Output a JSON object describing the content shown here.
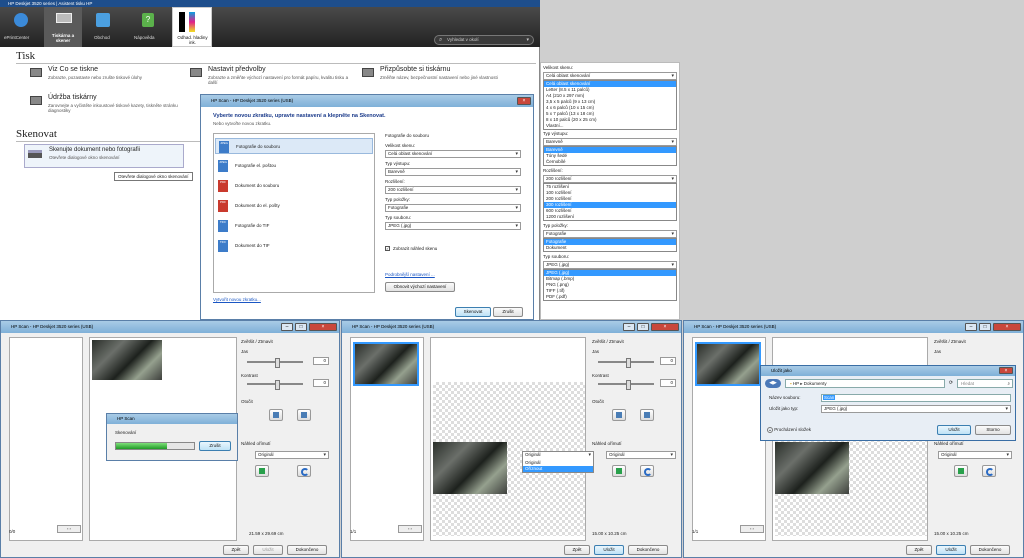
{
  "assistant": {
    "title": "HP Deskjet 3520 series | Asistent tisku HP",
    "tabs": [
      {
        "label": "ePrintCenter"
      },
      {
        "label": "Tiskárna a skener"
      },
      {
        "label": "Obchod"
      },
      {
        "label": "Nápověda"
      },
      {
        "label": "Odhad. hladiny ink."
      }
    ],
    "search_placeholder": "Vyhledat v okolí",
    "print_heading": "Tisk",
    "print_items": [
      {
        "title": "Viz Co se tiskne",
        "desc": "Zobrazte, pozastavte nebo zrušte tiskové úlohy"
      },
      {
        "title": "Nastavit předvolby",
        "desc": "Zobrazte a změňte výchozí nastavení pro formát papíru, kvalitu tisku a další"
      },
      {
        "title": "Přizpůsobte si tiskárnu",
        "desc": "Změňte název, bezpečnostní nastavení nebo jiné vlastnosti"
      },
      {
        "title": "Údržba tiskárny",
        "desc": "Zarovnejte a vyčistěte inkoustové tiskové kazety, tiskněte stránku diagnostiky"
      }
    ],
    "scan_heading": "Skenovat",
    "scan_item": {
      "title": "Skenujte dokument nebo fotografii",
      "desc": "Otevřete dialogové okno skenování"
    },
    "tooltip": "Otevřete dialogové okno skenování"
  },
  "scan_dialog": {
    "title": "HP Scan - HP Deskjet 3520 series (USB)",
    "heading": "Vyberte novou zkratku, upravte nastavení a klepněte na Skenovat.",
    "subheading": "Nebo vytvořte novou zkratku.",
    "shortcuts": [
      {
        "label": "Fotografie do souboru",
        "tag": "JPEG"
      },
      {
        "label": "Fotografie el. poštou",
        "tag": "JPEG"
      },
      {
        "label": "Dokument do souboru",
        "tag": "PDF"
      },
      {
        "label": "Dokument do el. pošty",
        "tag": "PDF"
      },
      {
        "label": "Fotografie do TIF",
        "tag": "TIFF"
      },
      {
        "label": "Dokument do TIF",
        "tag": "TIFF"
      }
    ],
    "settings_title": "Fotografie do souboru",
    "size_label": "Velikost skenu:",
    "size_value": "Celá oblast skenování",
    "color_label": "Typ výstupu:",
    "color_value": "Barevně",
    "res_label": "Rozlišení:",
    "res_value": "200 rozlišení",
    "item_label": "Typ položky:",
    "item_value": "Fotografie",
    "file_label": "Typ souboru:",
    "file_value": "JPEG (.jpg)",
    "preview_check": "Zobrazit náhled skenu",
    "more_settings": "Podrobnější nastavení ...",
    "reset_button": "Obnovit výchozí nastavení",
    "create_link": "Vytvořit novou zkratku...",
    "scan_button": "Skenovat",
    "cancel_button": "Zrušit"
  },
  "dropdowns": {
    "size_label": "Velikost skenu:",
    "size_value": "Celá oblast skenování",
    "size_options": [
      "Celá oblast skenování",
      "Letter (8.5 x 11 palců)",
      "A4 (210 x 297 mm)",
      "3,5 x 5 palců (9 x 13 cm)",
      "4 x 6 palců (10 x 15 cm)",
      "5 x 7 palců (13 x 18 cm)",
      "8 x 10 palců (20 x 25 cm)",
      "Vlastní..."
    ],
    "color_label": "Typ výstupu:",
    "color_value": "Barevně",
    "color_options": [
      "Barevně",
      "Tóny šedé",
      "Černobílé"
    ],
    "res_label": "Rozlišení:",
    "res_value": "200 rozlišení",
    "res_options": [
      "75 rozlišení",
      "100 rozlišení",
      "200 rozlišení",
      "300 rozlišení",
      "600 rozlišení",
      "1200 rozlišení"
    ],
    "item_label": "Typ položky:",
    "item_value": "Fotografie",
    "item_options": [
      "Fotografie",
      "Dokument"
    ],
    "file_label": "Typ souboru:",
    "file_value": "JPEG (.jpg)",
    "file_options": [
      "JPEG (.jpg)",
      "Bitmap (.bmp)",
      "PNG (.png)",
      "TIFF (.tif)",
      "PDF (.pdf)"
    ]
  },
  "preview": {
    "title": "HP Scan - HP Deskjet 3520 series (USB)",
    "zoom_label": "Zvětšit / Ztmavit",
    "brightness_label": "Jas",
    "brightness_value": "0",
    "contrast_label": "Kontrast",
    "contrast_value": "0",
    "rotate_label": "Otočit",
    "preview_label": "Náhled ořímutí",
    "preview_value": "Originál",
    "preview_options": [
      "Originál",
      "Oříznout"
    ],
    "page_count_0": "0/0",
    "page_count_1": "1/1",
    "size_a4": "21.59 x 29.69 cm",
    "size_photo": "15.00 x 10.25 cm",
    "back_button": "Zpět",
    "save_button": "Uložit",
    "done_button": "Dokončeno",
    "progress_title": "HP Scan",
    "progress_text": "Skenování",
    "progress_cancel": "Zrušit",
    "progress_fraction": 0.65
  },
  "save_dialog": {
    "title": "Uložit jako",
    "path": "HP ▸ Dokumenty",
    "search_placeholder": "Hledat",
    "name_label": "Název souboru:",
    "name_value": "Scan",
    "type_label": "Uložit jako typ:",
    "type_value": "JPEG (.jpg)",
    "browse_label": "Procházení složek",
    "save_button": "Uložit",
    "cancel_button": "Storno"
  },
  "colors": {
    "accent": "#3399ff",
    "titlebar": "#7fb0d8",
    "header_dark": "#2b2b2b"
  }
}
